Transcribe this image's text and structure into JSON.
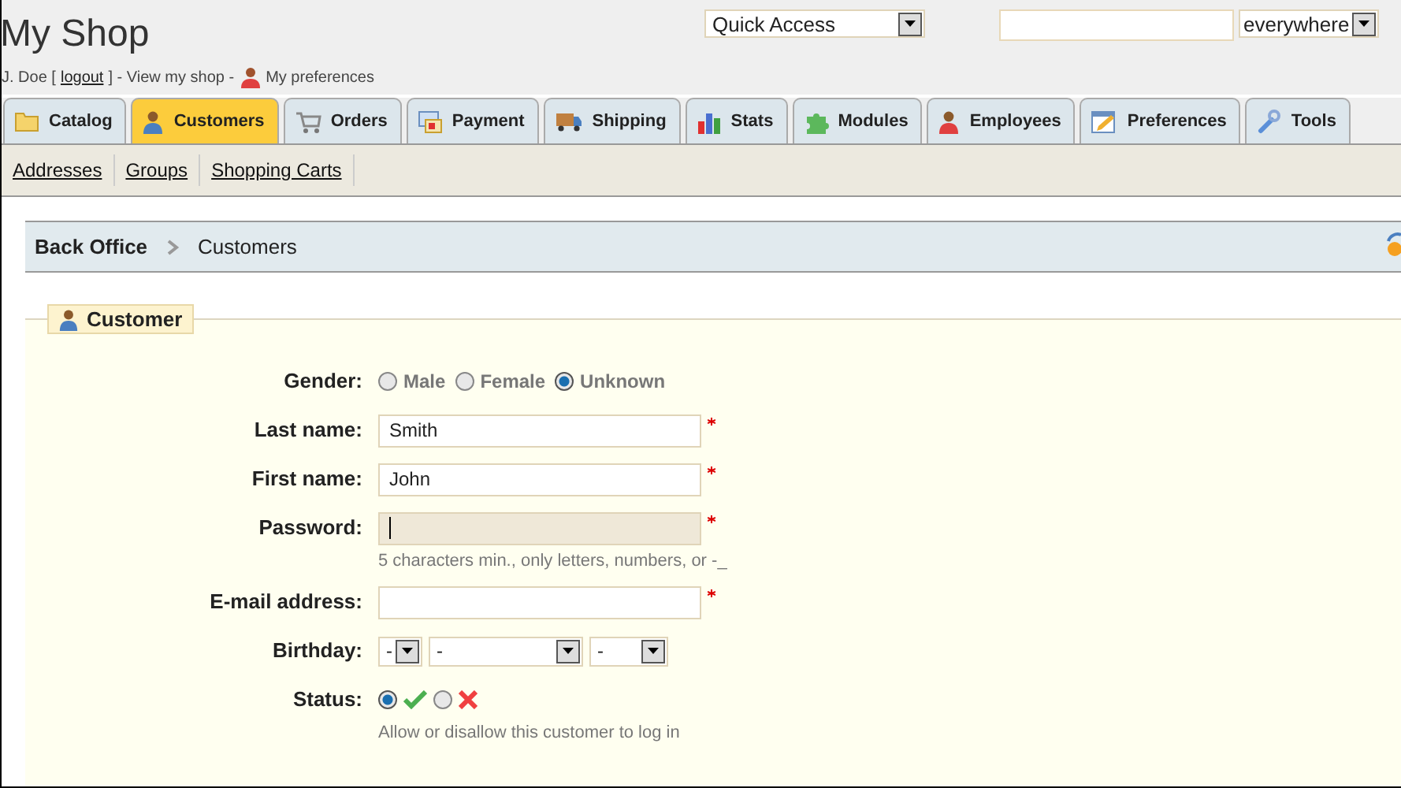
{
  "header": {
    "title": "My Shop",
    "user": "J. Doe [",
    "logout": "logout",
    "middle": "] - View my shop -",
    "preferences": "My preferences"
  },
  "quick_access": {
    "value": "Quick Access"
  },
  "search_scope": {
    "value": "everywhere"
  },
  "tabs": [
    {
      "label": "Catalog",
      "selected": false
    },
    {
      "label": "Customers",
      "selected": true
    },
    {
      "label": "Orders",
      "selected": false
    },
    {
      "label": "Payment",
      "selected": false
    },
    {
      "label": "Shipping",
      "selected": false
    },
    {
      "label": "Stats",
      "selected": false
    },
    {
      "label": "Modules",
      "selected": false
    },
    {
      "label": "Employees",
      "selected": false
    },
    {
      "label": "Preferences",
      "selected": false
    },
    {
      "label": "Tools",
      "selected": false
    }
  ],
  "subnav": [
    "Addresses",
    "Groups",
    "Shopping Carts"
  ],
  "breadcrumb": [
    "Back Office",
    "Customers"
  ],
  "form": {
    "legend": "Customer",
    "fields": [
      {
        "kind": "radio",
        "label": "Gender:",
        "options": [
          {
            "label": "Male",
            "selected": false
          },
          {
            "label": "Female",
            "selected": false
          },
          {
            "label": "Unknown",
            "selected": true
          }
        ]
      },
      {
        "kind": "text",
        "label": "Last name:",
        "value": "Smith",
        "required": true,
        "focused": false
      },
      {
        "kind": "text",
        "label": "First name:",
        "value": "John",
        "required": true,
        "focused": false
      },
      {
        "kind": "text",
        "label": "Password:",
        "required": true,
        "focused": true,
        "hint": "5 characters min., only letters, numbers, or -_"
      },
      {
        "kind": "text",
        "label": "E-mail address:",
        "required": true,
        "focused": false
      },
      {
        "kind": "selects",
        "label": "Birthday:",
        "selects": [
          "-",
          "-",
          "-"
        ]
      },
      {
        "kind": "status",
        "label": "Status:",
        "options": [
          {
            "selected": true
          },
          {
            "selected": false
          }
        ],
        "hint": "Allow or disallow this customer to log in"
      }
    ]
  }
}
